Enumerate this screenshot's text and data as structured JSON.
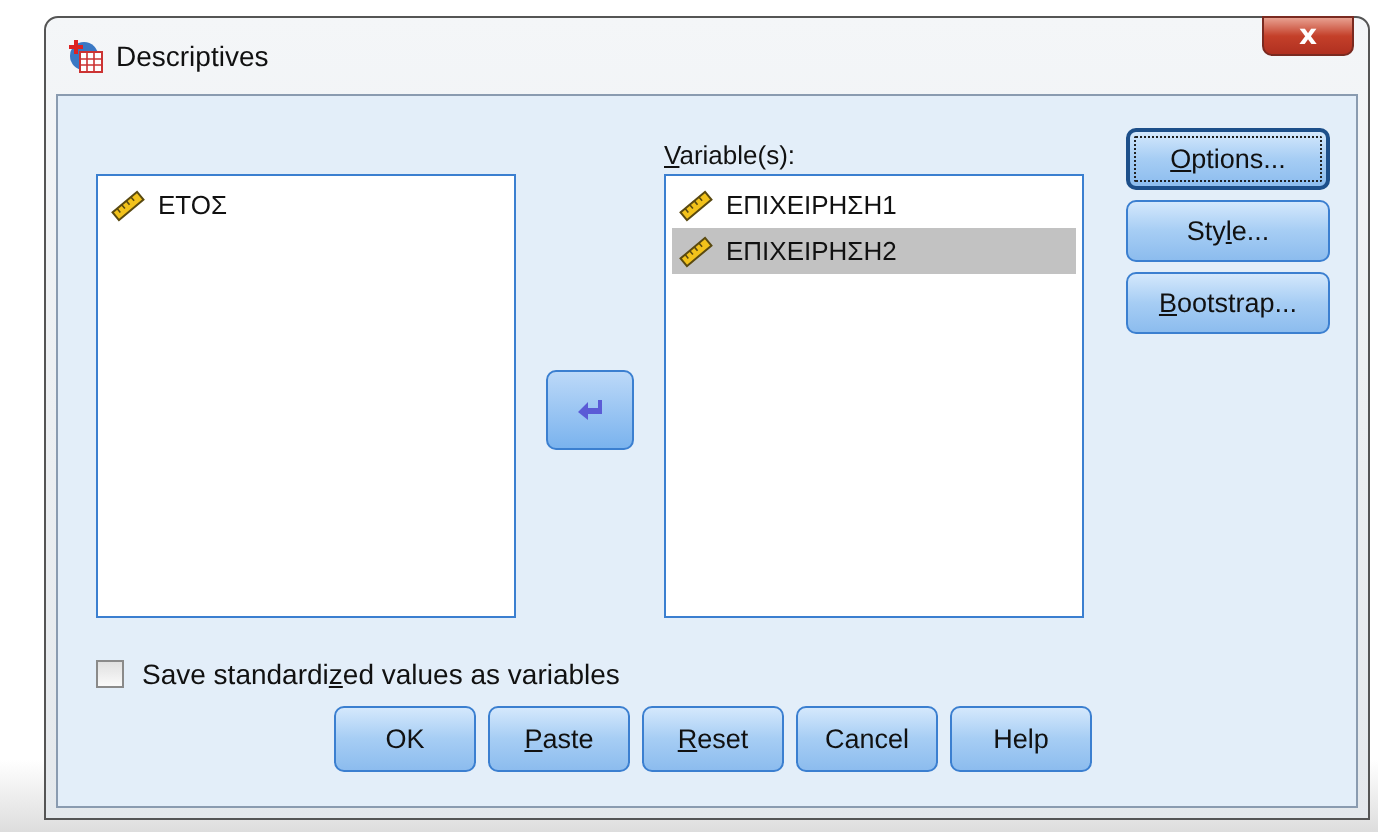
{
  "window": {
    "title": "Descriptives",
    "close": "x"
  },
  "source_list": {
    "items": [
      {
        "label": "ΕΤΟΣ",
        "selected": false
      }
    ]
  },
  "target_list": {
    "label": {
      "key": "V",
      "post": "ariable(s):"
    },
    "items": [
      {
        "label": "ΕΠΙΧΕΙΡΗΣΗ1",
        "selected": false
      },
      {
        "label": "ΕΠΙΧΕΙΡΗΣΗ2",
        "selected": true
      }
    ]
  },
  "side_buttons": [
    {
      "key": "O",
      "post": "ptions...",
      "focused": true
    },
    {
      "pre": "Sty",
      "key": "l",
      "post": "e...",
      "focused": false
    },
    {
      "key": "B",
      "post": "ootstrap...",
      "focused": false
    }
  ],
  "checkbox": {
    "pre": "Save standardi",
    "key": "z",
    "post": "ed values as variables",
    "checked": false
  },
  "bottom_buttons": [
    {
      "pre": "OK"
    },
    {
      "key": "P",
      "post": "aste"
    },
    {
      "key": "R",
      "post": "eset"
    },
    {
      "pre": "Cancel"
    },
    {
      "pre": "Help"
    }
  ]
}
